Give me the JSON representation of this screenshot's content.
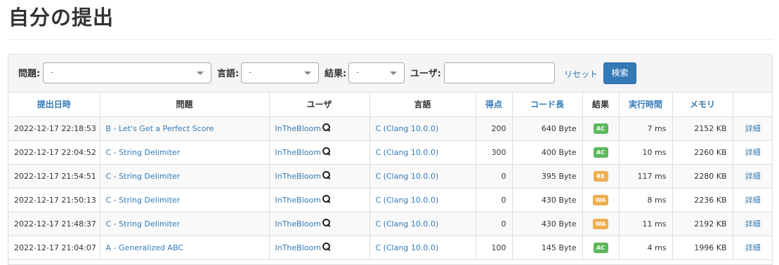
{
  "page": {
    "title": "自分の提出"
  },
  "filters": {
    "problem_label": "問題:",
    "problem_value": "-",
    "language_label": "言語:",
    "language_value": "-",
    "result_label": "結果:",
    "result_value": "-",
    "user_label": "ユーザ:",
    "user_value": "",
    "reset_label": "リセット",
    "search_label": "検索"
  },
  "table": {
    "headers": {
      "date": "提出日時",
      "problem": "問題",
      "user": "ユーザ",
      "language": "言語",
      "score": "得点",
      "code_length": "コード長",
      "result": "結果",
      "exec_time": "実行時間",
      "memory": "メモリ",
      "detail": ""
    },
    "rows": [
      {
        "date": "2022-12-17 22:18:53",
        "problem": "B - Let's Get a Perfect Score",
        "user": "InTheBloom",
        "language": "C (Clang 10.0.0)",
        "score": "200",
        "code_length": "640 Byte",
        "result": "AC",
        "result_color": "#5cb85c",
        "time": "7 ms",
        "memory": "2152 KB",
        "detail": "詳細"
      },
      {
        "date": "2022-12-17 22:04:52",
        "problem": "C - String Delimiter",
        "user": "InTheBloom",
        "language": "C (Clang 10.0.0)",
        "score": "300",
        "code_length": "400 Byte",
        "result": "AC",
        "result_color": "#5cb85c",
        "time": "10 ms",
        "memory": "2260 KB",
        "detail": "詳細"
      },
      {
        "date": "2022-12-17 21:54:51",
        "problem": "C - String Delimiter",
        "user": "InTheBloom",
        "language": "C (Clang 10.0.0)",
        "score": "0",
        "code_length": "395 Byte",
        "result": "RE",
        "result_color": "#f0ad4e",
        "time": "117 ms",
        "memory": "2280 KB",
        "detail": "詳細"
      },
      {
        "date": "2022-12-17 21:50:13",
        "problem": "C - String Delimiter",
        "user": "InTheBloom",
        "language": "C (Clang 10.0.0)",
        "score": "0",
        "code_length": "430 Byte",
        "result": "WA",
        "result_color": "#f0ad4e",
        "time": "8 ms",
        "memory": "2236 KB",
        "detail": "詳細"
      },
      {
        "date": "2022-12-17 21:48:37",
        "problem": "C - String Delimiter",
        "user": "InTheBloom",
        "language": "C (Clang 10.0.0)",
        "score": "0",
        "code_length": "430 Byte",
        "result": "WA",
        "result_color": "#f0ad4e",
        "time": "11 ms",
        "memory": "2192 KB",
        "detail": "詳細"
      },
      {
        "date": "2022-12-17 21:04:07",
        "problem": "A - Generalized ABC",
        "user": "InTheBloom",
        "language": "C (Clang 10.0.0)",
        "score": "100",
        "code_length": "145 Byte",
        "result": "AC",
        "result_color": "#5cb85c",
        "time": "4 ms",
        "memory": "1996 KB",
        "detail": "詳細"
      }
    ]
  }
}
